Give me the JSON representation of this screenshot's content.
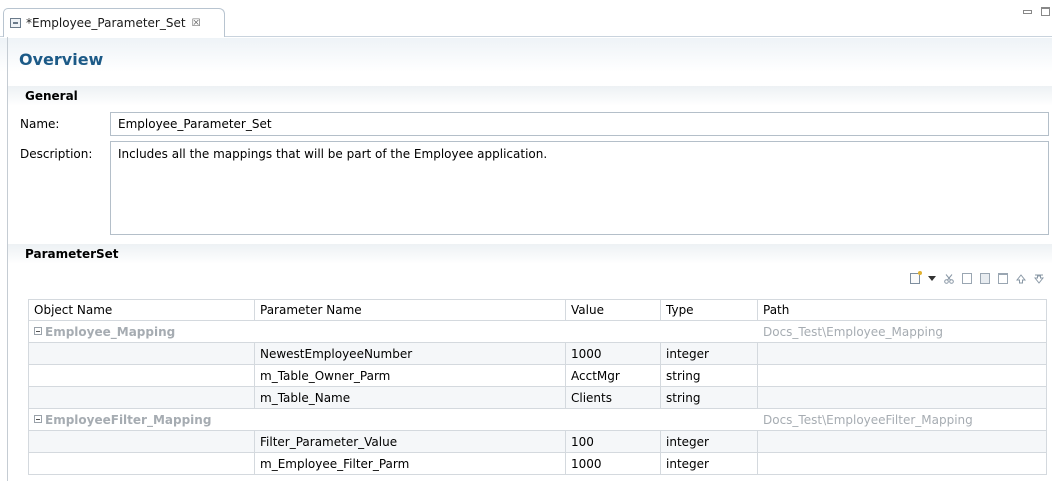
{
  "editor": {
    "tab_title": "*Employee_Parameter_Set",
    "tab_close_glyph": "☒",
    "tab_icon": "parameter-set-icon"
  },
  "overview": {
    "title": "Overview"
  },
  "general": {
    "section_title": "General",
    "name_label": "Name:",
    "name_value": "Employee_Parameter_Set",
    "description_label": "Description:",
    "description_value": "Includes all the mappings that will be part of the Employee application."
  },
  "parameter_set": {
    "section_title": "ParameterSet",
    "toolbar_icons": [
      "new-icon",
      "dropdown-arrow-icon",
      "cut-icon",
      "copy-icon",
      "paste-icon",
      "delete-icon",
      "move-up-icon",
      "move-down-icon"
    ],
    "columns": [
      "Object Name",
      "Parameter Name",
      "Value",
      "Type",
      "Path"
    ],
    "rows": [
      {
        "kind": "group",
        "object": "Employee_Mapping",
        "parameter": "",
        "value": "",
        "type": "",
        "path": "Docs_Test\\Employee_Mapping"
      },
      {
        "kind": "param",
        "object": "",
        "parameter": "NewestEmployeeNumber",
        "value": "1000",
        "type": "integer",
        "path": ""
      },
      {
        "kind": "param",
        "object": "",
        "parameter": "m_Table_Owner_Parm",
        "value": "AcctMgr",
        "type": "string",
        "path": ""
      },
      {
        "kind": "param",
        "object": "",
        "parameter": "m_Table_Name",
        "value": "Clients",
        "type": "string",
        "path": ""
      },
      {
        "kind": "group",
        "object": "EmployeeFilter_Mapping",
        "parameter": "",
        "value": "",
        "type": "",
        "path": "Docs_Test\\EmployeeFilter_Mapping"
      },
      {
        "kind": "param",
        "object": "",
        "parameter": "Filter_Parameter_Value",
        "value": "100",
        "type": "integer",
        "path": ""
      },
      {
        "kind": "param",
        "object": "",
        "parameter": "m_Employee_Filter_Parm",
        "value": "1000",
        "type": "integer",
        "path": ""
      }
    ]
  },
  "colors": {
    "header_blue": "#1c5a87",
    "group_gray": "#a6acb2",
    "border": "#d4d9de"
  }
}
